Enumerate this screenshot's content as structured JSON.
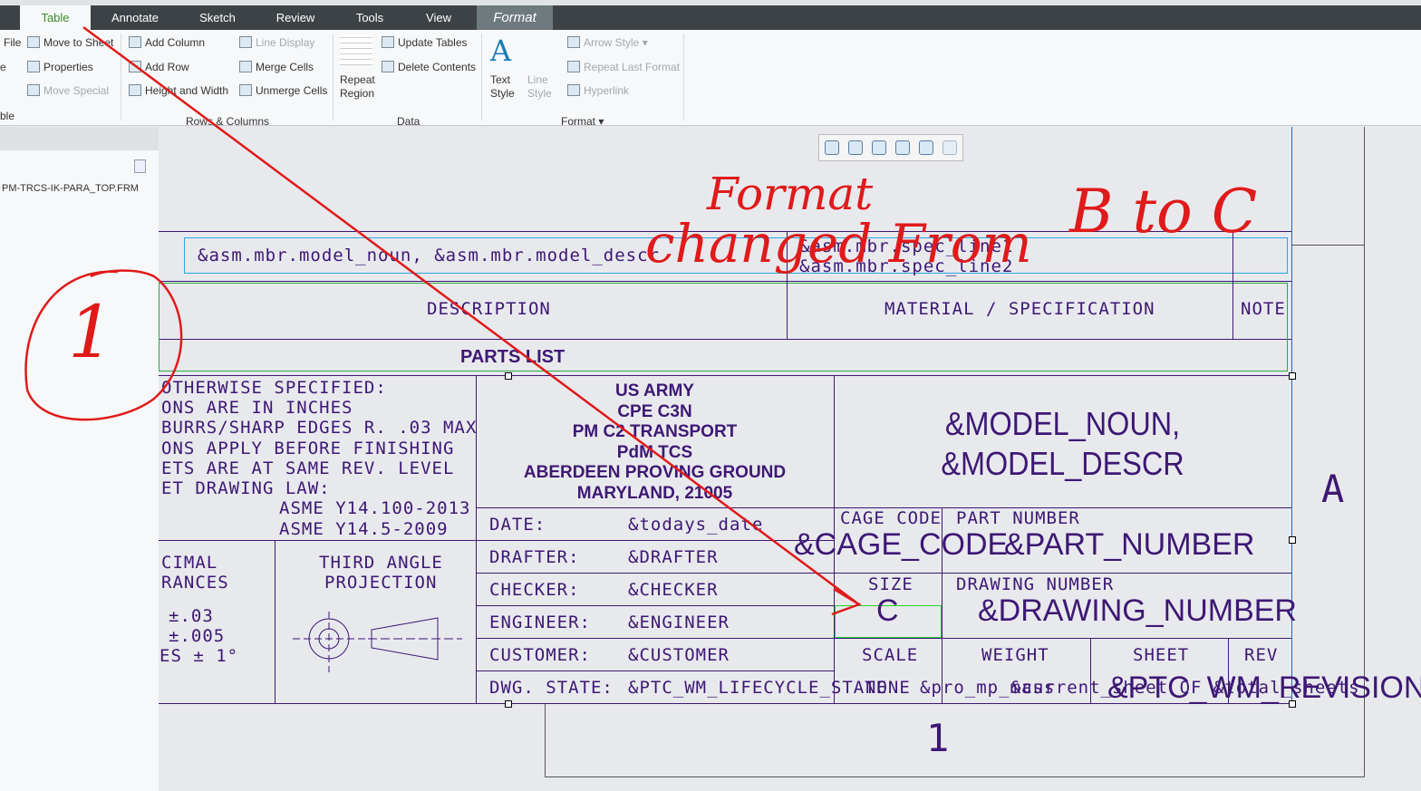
{
  "tabs": [
    {
      "label": "Table",
      "active": true
    },
    {
      "label": "Annotate"
    },
    {
      "label": "Sketch"
    },
    {
      "label": "Review"
    },
    {
      "label": "Tools"
    },
    {
      "label": "View"
    },
    {
      "label": "Format",
      "contextual": true
    }
  ],
  "ribbon": {
    "partial": {
      "file": "File",
      "e": "e",
      "ble": "ble"
    },
    "move_to_sheet": "Move to Sheet",
    "properties": "Properties",
    "move_special": "Move Special",
    "add_column": "Add Column",
    "add_row": "Add Row",
    "height_width": "Height and Width",
    "line_display": "Line Display",
    "merge_cells": "Merge Cells",
    "unmerge_cells": "Unmerge Cells",
    "repeat_region": "Repeat Region",
    "update_tables": "Update Tables",
    "delete_contents": "Delete Contents",
    "text_style": "Text Style",
    "line_style": "Line Style",
    "arrow_style": "Arrow Style",
    "repeat_last_format": "Repeat Last Format",
    "hyperlink": "Hyperlink",
    "groups": {
      "rows_columns": "Rows & Columns",
      "data": "Data",
      "format": "Format"
    }
  },
  "left_panel": {
    "filename": "PM-TRCS-IK-PARA_TOP.FRM"
  },
  "drawing": {
    "model_line": "&asm.mbr.model_noun, &asm.mbr.model_descr",
    "spec_line1": "&asm.mbr.spec_line1",
    "spec_line2": "&asm.mbr.spec_line2",
    "description": "DESCRIPTION",
    "material": "MATERIAL / SPECIFICATION",
    "note": "NOTE",
    "parts_list": "PARTS LIST",
    "notes": [
      "OTHERWISE SPECIFIED:",
      "ONS ARE IN INCHES",
      "BURRS/SHARP EDGES R. .03 MAX",
      "ONS APPLY BEFORE FINISHING",
      "ETS ARE AT SAME REV. LEVEL",
      "ET DRAWING LAW:",
      "ASME Y14.100-2013",
      "ASME Y14.5-2009"
    ],
    "org": [
      "US ARMY",
      "CPE C3N",
      "PM C2 TRANSPORT",
      "PdM TCS",
      "ABERDEEN PROVING GROUND",
      "MARYLAND, 21005"
    ],
    "model_noun": "&MODEL_NOUN,",
    "model_descr": "&MODEL_DESCR",
    "tolerances": [
      "CIMAL",
      "RANCES",
      "±.03",
      "±.005",
      "ES ± 1°"
    ],
    "projection": [
      "THIRD ANGLE",
      "PROJECTION"
    ],
    "fields": [
      {
        "label": "DATE:",
        "value": "&todays_date"
      },
      {
        "label": "DRAFTER:",
        "value": "&DRAFTER"
      },
      {
        "label": "CHECKER:",
        "value": "&CHECKER"
      },
      {
        "label": "ENGINEER:",
        "value": "&ENGINEER"
      },
      {
        "label": "CUSTOMER:",
        "value": "&CUSTOMER"
      },
      {
        "label": "DWG. STATE:",
        "value": "&PTC_WM_LIFECYCLE_STATE"
      }
    ],
    "cage_code_label": "CAGE CODE",
    "cage_code": "&CAGE_CODE",
    "part_number_label": "PART NUMBER",
    "part_number": "&PART_NUMBER",
    "size_label": "SIZE",
    "size": "C",
    "drawing_number_label": "DRAWING NUMBER",
    "drawing_number": "&DRAWING_NUMBER",
    "scale_label": "SCALE",
    "weight_label": "WEIGHT",
    "sheet_label": "SHEET",
    "rev_label": "REV",
    "scale": "NONE",
    "weight": "&pro_mp_mass",
    "sheet": "&current_sheet OF &total_sheets",
    "rev": "&PTC_WM_REVISION:D",
    "zone_letter": "A",
    "zone_number": "1"
  },
  "annotation": {
    "line1": "Format",
    "line2": "changed From",
    "line3": "B to C",
    "circled": "1",
    "color": "#e01a1a"
  }
}
